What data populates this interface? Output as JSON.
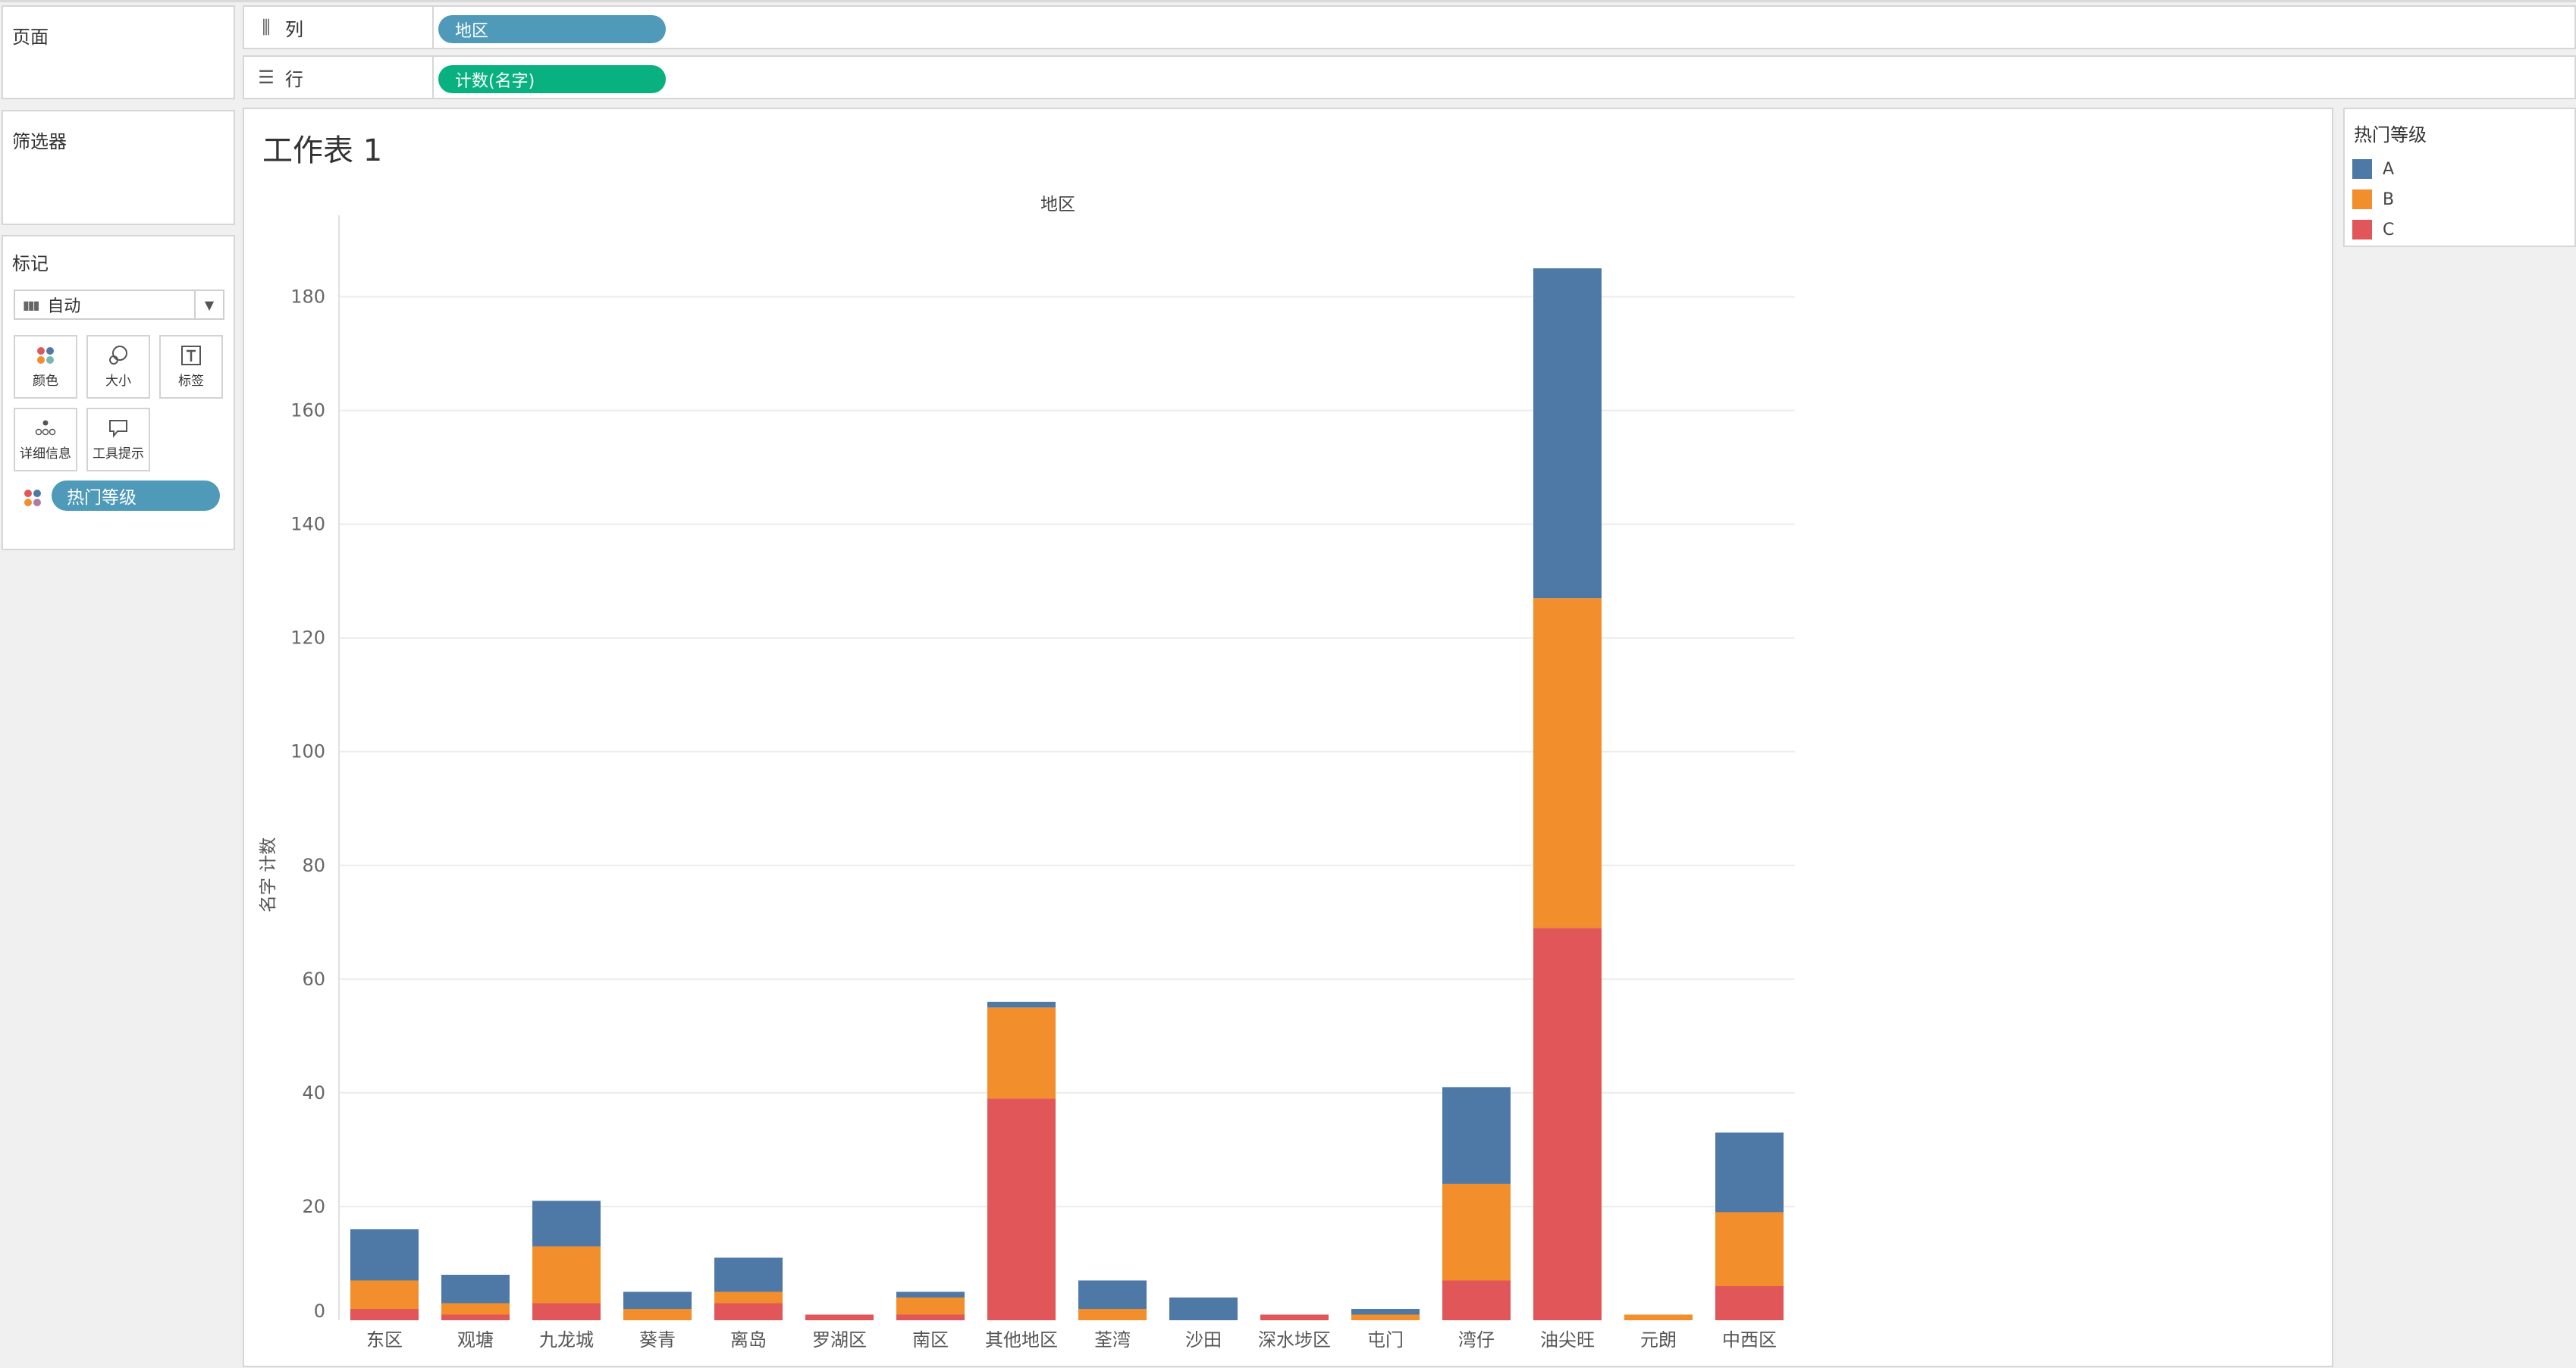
{
  "panels": {
    "pages_title": "页面",
    "filters_title": "筛选器",
    "marks_title": "标记"
  },
  "shelves": {
    "columns": {
      "label": "列",
      "pill": "地区"
    },
    "rows": {
      "label": "行",
      "pill": "计数(名字)"
    }
  },
  "marks": {
    "type_select": "自动",
    "buttons": [
      {
        "label": "颜色",
        "icon": "color-icon"
      },
      {
        "label": "大小",
        "icon": "size-icon"
      },
      {
        "label": "标签",
        "icon": "label-icon"
      },
      {
        "label": "详细信息",
        "icon": "detail-icon"
      },
      {
        "label": "工具提示",
        "icon": "tooltip-icon"
      }
    ],
    "color_field": "热门等级"
  },
  "sheet": {
    "title": "工作表 1",
    "x_field": "地区",
    "y_axis_title": "名字 计数"
  },
  "legend": {
    "title": "热门等级",
    "items": [
      {
        "label": "A",
        "color": "#4e79a7"
      },
      {
        "label": "B",
        "color": "#f28e2b"
      },
      {
        "label": "C",
        "color": "#e15759"
      }
    ]
  },
  "chart_data": {
    "type": "bar",
    "stacked": true,
    "categories": [
      "东区",
      "观塘",
      "九龙城",
      "葵青",
      "离岛",
      "罗湖区",
      "南区",
      "其他地区",
      "荃湾",
      "沙田",
      "深水埗区",
      "屯门",
      "湾仔",
      "油尖旺",
      "元朗",
      "中西区"
    ],
    "series": [
      {
        "name": "C",
        "color": "#e15759",
        "values": [
          2,
          1,
          3,
          0,
          3,
          1,
          1,
          39,
          0,
          0,
          1,
          0,
          7,
          69,
          0,
          6
        ]
      },
      {
        "name": "B",
        "color": "#f28e2b",
        "values": [
          5,
          2,
          10,
          2,
          2,
          0,
          3,
          16,
          2,
          0,
          0,
          1,
          17,
          58,
          1,
          13
        ]
      },
      {
        "name": "A",
        "color": "#4e79a7",
        "values": [
          9,
          5,
          8,
          3,
          6,
          0,
          1,
          1,
          5,
          4,
          0,
          1,
          17,
          58,
          0,
          14
        ]
      }
    ],
    "ylabel": "名字 计数",
    "xlabel": "地区",
    "ylim": [
      0,
      193
    ],
    "yticks": [
      0,
      20,
      40,
      60,
      80,
      100,
      120,
      140,
      160,
      180
    ],
    "grid": true
  }
}
